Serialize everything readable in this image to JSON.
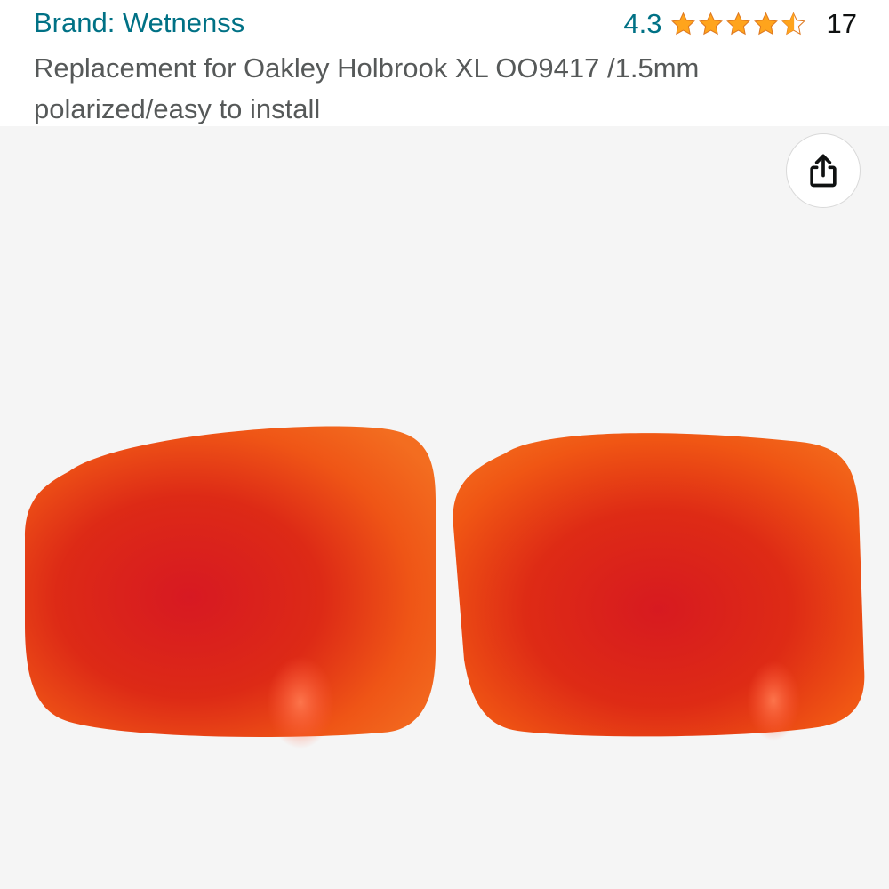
{
  "header": {
    "brand_label": "Brand: Wetnenss",
    "rating_value": "4.3",
    "rating_count": "17",
    "stars_out_of_5": 4.3
  },
  "product": {
    "title": "Replacement for Oakley Holbrook XL OO9417 /1.5mm polarized/easy to install"
  },
  "share": {
    "icon": "share-icon"
  },
  "colors": {
    "link": "#007185",
    "star": "#ffa41c",
    "title_text": "#565959",
    "image_background": "#f5f5f5",
    "lens_red": "#d6231b",
    "lens_orange": "#f15a12"
  }
}
